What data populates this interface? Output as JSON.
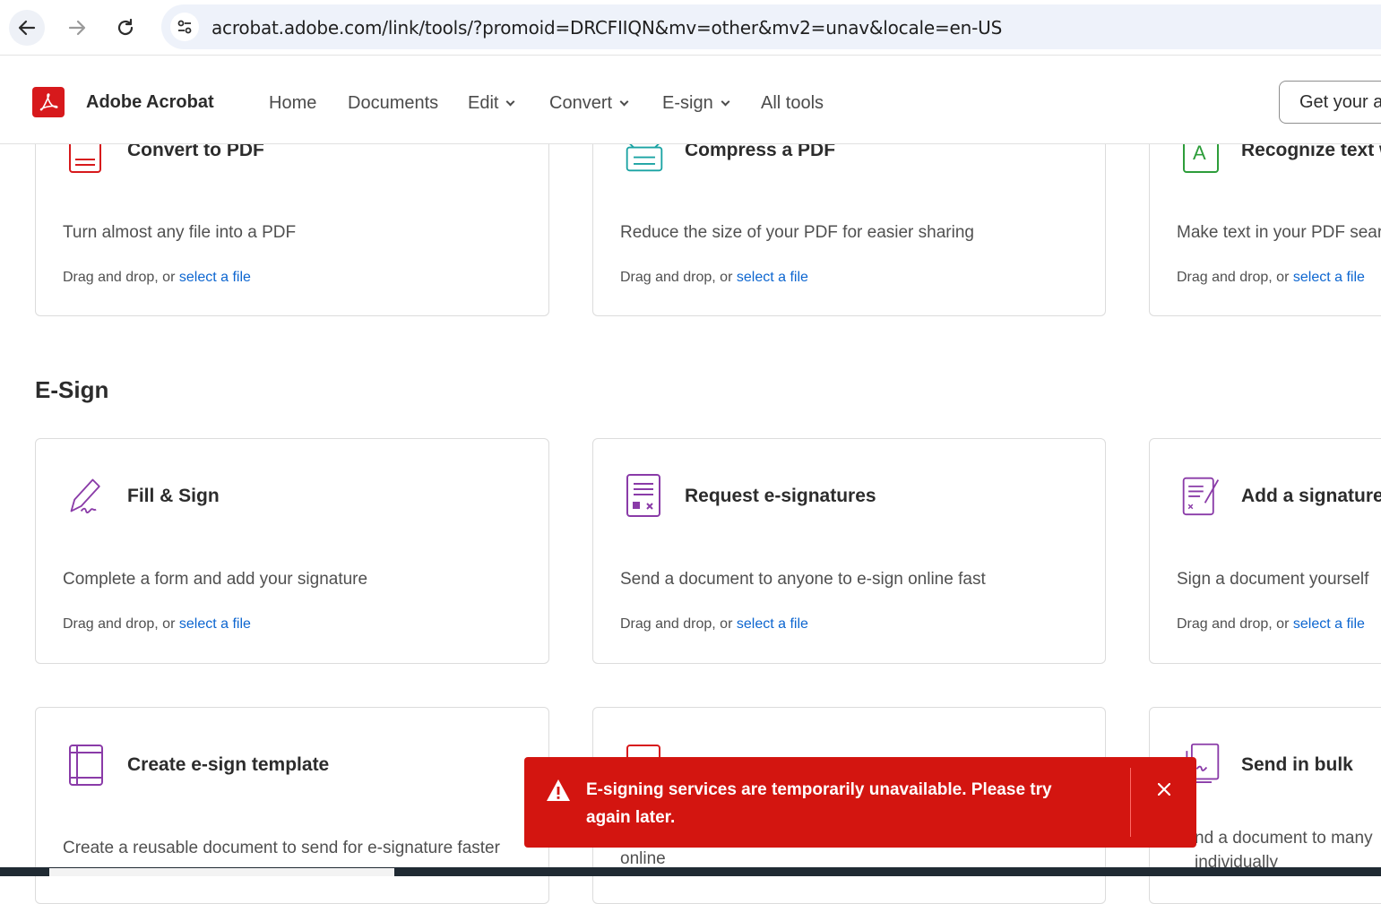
{
  "browser": {
    "url": "acrobat.adobe.com/link/tools/?promoid=DRCFIIQN&mv=other&mv2=unav&locale=en-US"
  },
  "header": {
    "brand": "Adobe Acrobat",
    "nav": {
      "home": "Home",
      "documents": "Documents",
      "edit": "Edit",
      "convert": "Convert",
      "esign": "E-sign",
      "all_tools": "All tools"
    },
    "cta": "Get your app"
  },
  "drop_prefix": "Drag and drop, or ",
  "drop_link": "select a file",
  "top_cards": [
    {
      "title": "Convert to PDF",
      "desc": "Turn almost any file into a PDF",
      "icon": "convert-to-pdf-icon"
    },
    {
      "title": "Compress a PDF",
      "desc": "Reduce the size of your PDF for easier sharing",
      "icon": "compress-pdf-icon"
    },
    {
      "title": "Recognize text w",
      "desc": "Make text in your PDF sear",
      "icon": "recognize-text-icon"
    }
  ],
  "esign_section": {
    "title": "E-Sign",
    "cards": [
      {
        "title": "Fill & Sign",
        "desc": "Complete a form and add your signature",
        "icon": "fill-sign-icon"
      },
      {
        "title": "Request e-signatures",
        "desc": "Send a document to anyone to e-sign online fast",
        "icon": "request-esignatures-icon"
      },
      {
        "title": "Add a signature",
        "desc": "Sign a document yourself",
        "icon": "add-signature-icon"
      },
      {
        "title": "Create e-sign template",
        "desc": "Create a reusable document to send for e-signature faster",
        "icon": "esign-template-icon"
      },
      {
        "title": "",
        "desc": "online",
        "icon": "document-icon"
      },
      {
        "title": "Send in bulk",
        "desc": "nd a document to many individually",
        "icon": "send-bulk-icon"
      }
    ]
  },
  "toast": {
    "message": "E-signing services are temporarily unavailable. Please try again later.",
    "icon": "warning-icon"
  },
  "colors": {
    "accent_red": "#d7191c",
    "toast_red": "#d31510",
    "link_blue": "#0d66d0",
    "esign_purple": "#8a3ba8"
  }
}
